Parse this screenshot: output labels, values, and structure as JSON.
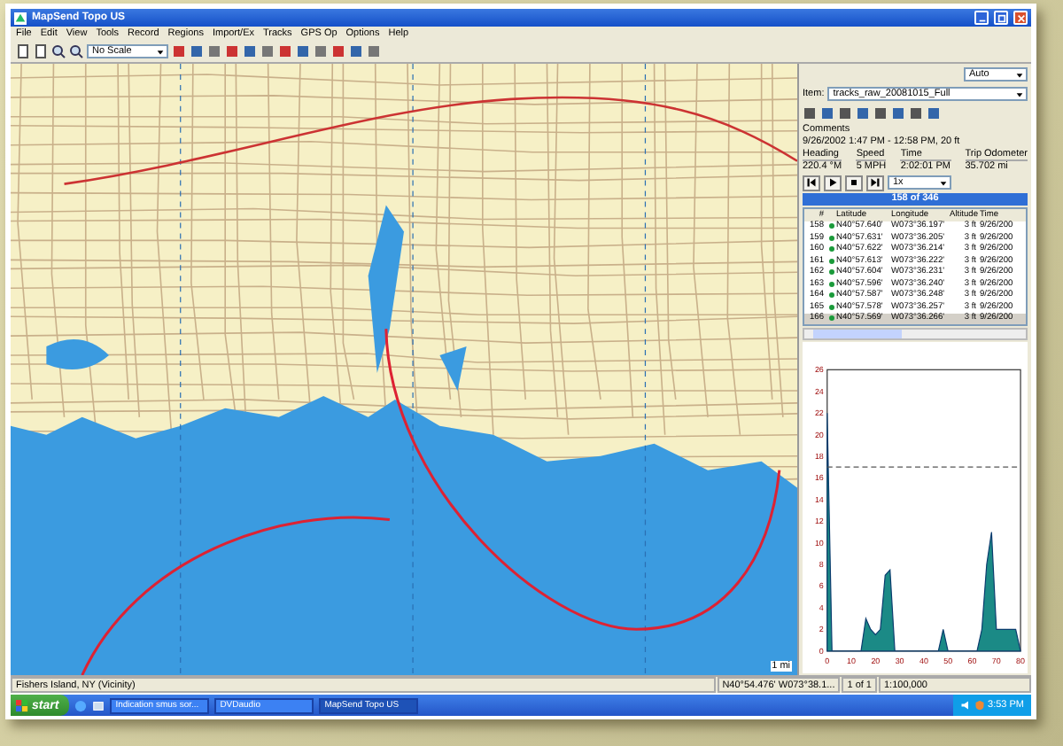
{
  "window": {
    "title": "MapSend Topo US"
  },
  "menu": [
    "File",
    "Edit",
    "View",
    "Tools",
    "Record",
    "Regions",
    "Import/Ex",
    "Tracks",
    "GPS Op",
    "Options",
    "Help"
  ],
  "toolbar": {
    "scale": "No Scale"
  },
  "map": {
    "scale_label": "1 mi"
  },
  "panel": {
    "view_mode": "Auto",
    "item_label": "Item:",
    "item_value": "tracks_raw_20081015_Full",
    "comments_label": "Comments",
    "comments": "9/26/2002 1:47 PM - 12:58 PM, 20 ft",
    "stats": [
      {
        "label": "Heading",
        "value": "220.4 °M"
      },
      {
        "label": "Speed",
        "value": "5 MPH"
      },
      {
        "label": "Time",
        "value": "2:02:01 PM"
      },
      {
        "label": "Trip Odometer",
        "value": "35.702 mi"
      }
    ],
    "playback_speed": "1x",
    "position": "158 of 346",
    "table": {
      "columns": [
        "#",
        "",
        "Latitude",
        "Longitude",
        "Altitude",
        "Time"
      ],
      "rows": [
        {
          "cells": [
            "158",
            "",
            "N40°57.640'",
            "W073°36.197'",
            "3 ft",
            "9/26/200"
          ],
          "selected": false
        },
        {
          "cells": [
            "159",
            "",
            "N40°57.631'",
            "W073°36.205'",
            "3 ft",
            "9/26/200"
          ],
          "selected": false
        },
        {
          "cells": [
            "160",
            "",
            "N40°57.622'",
            "W073°36.214'",
            "3 ft",
            "9/26/200"
          ],
          "selected": false
        },
        {
          "cells": [
            "161",
            "",
            "N40°57.613'",
            "W073°36.222'",
            "3 ft",
            "9/26/200"
          ],
          "selected": false
        },
        {
          "cells": [
            "162",
            "",
            "N40°57.604'",
            "W073°36.231'",
            "3 ft",
            "9/26/200"
          ],
          "selected": false
        },
        {
          "cells": [
            "163",
            "",
            "N40°57.596'",
            "W073°36.240'",
            "3 ft",
            "9/26/200"
          ],
          "selected": false
        },
        {
          "cells": [
            "164",
            "",
            "N40°57.587'",
            "W073°36.248'",
            "3 ft",
            "9/26/200"
          ],
          "selected": false
        },
        {
          "cells": [
            "165",
            "",
            "N40°57.578'",
            "W073°36.257'",
            "3 ft",
            "9/26/200"
          ],
          "selected": false
        },
        {
          "cells": [
            "166",
            "",
            "N40°57.569'",
            "W073°36.266'",
            "3 ft",
            "9/26/200"
          ],
          "selected": true
        }
      ]
    },
    "chart_data": {
      "type": "area",
      "x": [
        0,
        2,
        4,
        6,
        8,
        10,
        12,
        14,
        16,
        18,
        20,
        22,
        24,
        26,
        28,
        30,
        32,
        34,
        36,
        38,
        40,
        42,
        44,
        46,
        48,
        50,
        52,
        54,
        56,
        58,
        60,
        62,
        64,
        66,
        68,
        70,
        72,
        74,
        76,
        78,
        80
      ],
      "series": [
        {
          "color": "#1b8a86",
          "values": [
            22,
            0,
            0,
            0,
            0,
            0,
            0,
            0,
            3,
            2,
            1.5,
            2,
            7,
            7.5,
            0,
            0,
            0,
            0,
            0,
            0,
            0,
            0,
            0,
            0,
            2,
            0,
            0,
            0,
            0,
            0,
            0,
            0,
            2,
            8,
            11,
            2,
            2,
            2,
            2,
            2,
            0
          ]
        }
      ],
      "xlim": [
        0,
        80
      ],
      "ylim": [
        0,
        26
      ],
      "xticks": [
        0,
        10,
        20,
        30,
        40,
        50,
        60,
        70,
        80
      ],
      "yticks": [
        0,
        2,
        4,
        6,
        8,
        10,
        12,
        14,
        16,
        18,
        20,
        22,
        24,
        26
      ],
      "ref_lines": [
        {
          "axis": "y",
          "value": 17
        }
      ]
    }
  },
  "status_bar": {
    "place": "Fishers Island, NY (Vicinity)",
    "coords": "N40°54.476' W073°38.1...",
    "count": "1 of 1",
    "scale": "1:100,000"
  },
  "taskbar": {
    "start": "start",
    "tasks": [
      {
        "label": "Indication smus sor...",
        "selected": false
      },
      {
        "label": "DVDaudio",
        "selected": false
      },
      {
        "label": "MapSend Topo US",
        "selected": true
      }
    ],
    "clock": "3:53 PM"
  }
}
